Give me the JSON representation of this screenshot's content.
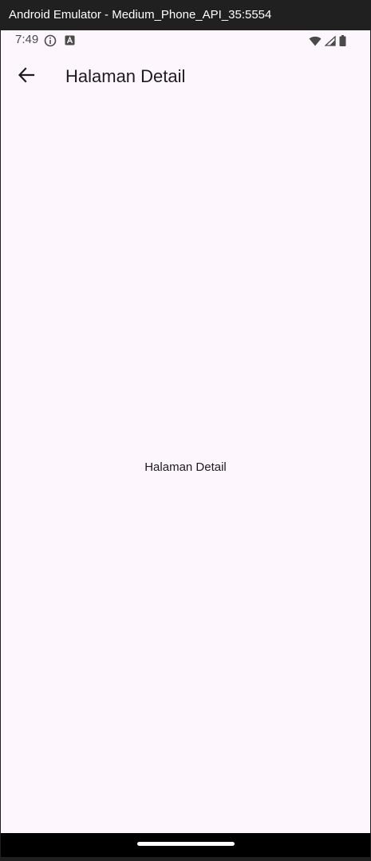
{
  "window": {
    "title": "Android Emulator - Medium_Phone_API_35:5554"
  },
  "status_bar": {
    "time": "7:49",
    "icons": [
      "info-icon",
      "a-badge-icon",
      "wifi-icon",
      "signal-icon",
      "battery-icon"
    ]
  },
  "app_bar": {
    "back_icon": "arrow-left-icon",
    "title": "Halaman Detail"
  },
  "body": {
    "text": "Halaman Detail"
  },
  "colors": {
    "background": "#fdf7fd",
    "text": "#1d1b20",
    "titlebar": "#202020"
  }
}
